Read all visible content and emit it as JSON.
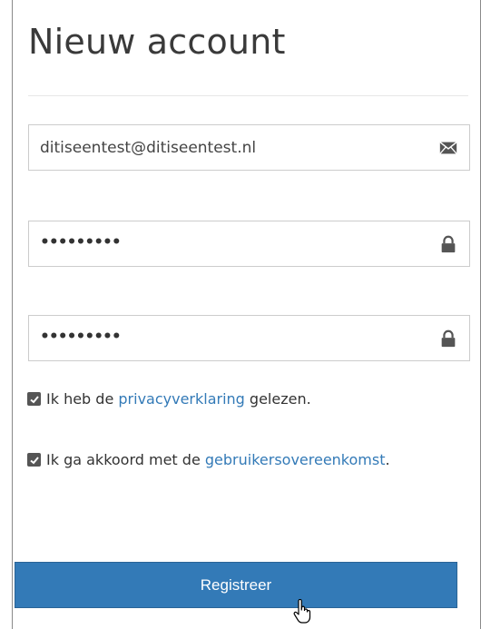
{
  "form": {
    "title": "Nieuw account",
    "email": {
      "value": "ditiseentest@ditiseentest.nl",
      "icon": "envelope-icon"
    },
    "password": {
      "masked": "•••••••••",
      "icon": "lock-icon"
    },
    "password_confirm": {
      "masked": "•••••••••",
      "icon": "lock-icon"
    },
    "privacy": {
      "checked": true,
      "prefix": "Ik heb de ",
      "link": "privacyverklaring",
      "suffix": " gelezen."
    },
    "terms": {
      "checked": true,
      "prefix": "Ik ga akkoord met de ",
      "link": "gebruikersovereenkomst",
      "suffix": "."
    },
    "submit_label": "Registreer"
  },
  "colors": {
    "accent": "#337ab7",
    "checkbox": "#555555"
  }
}
